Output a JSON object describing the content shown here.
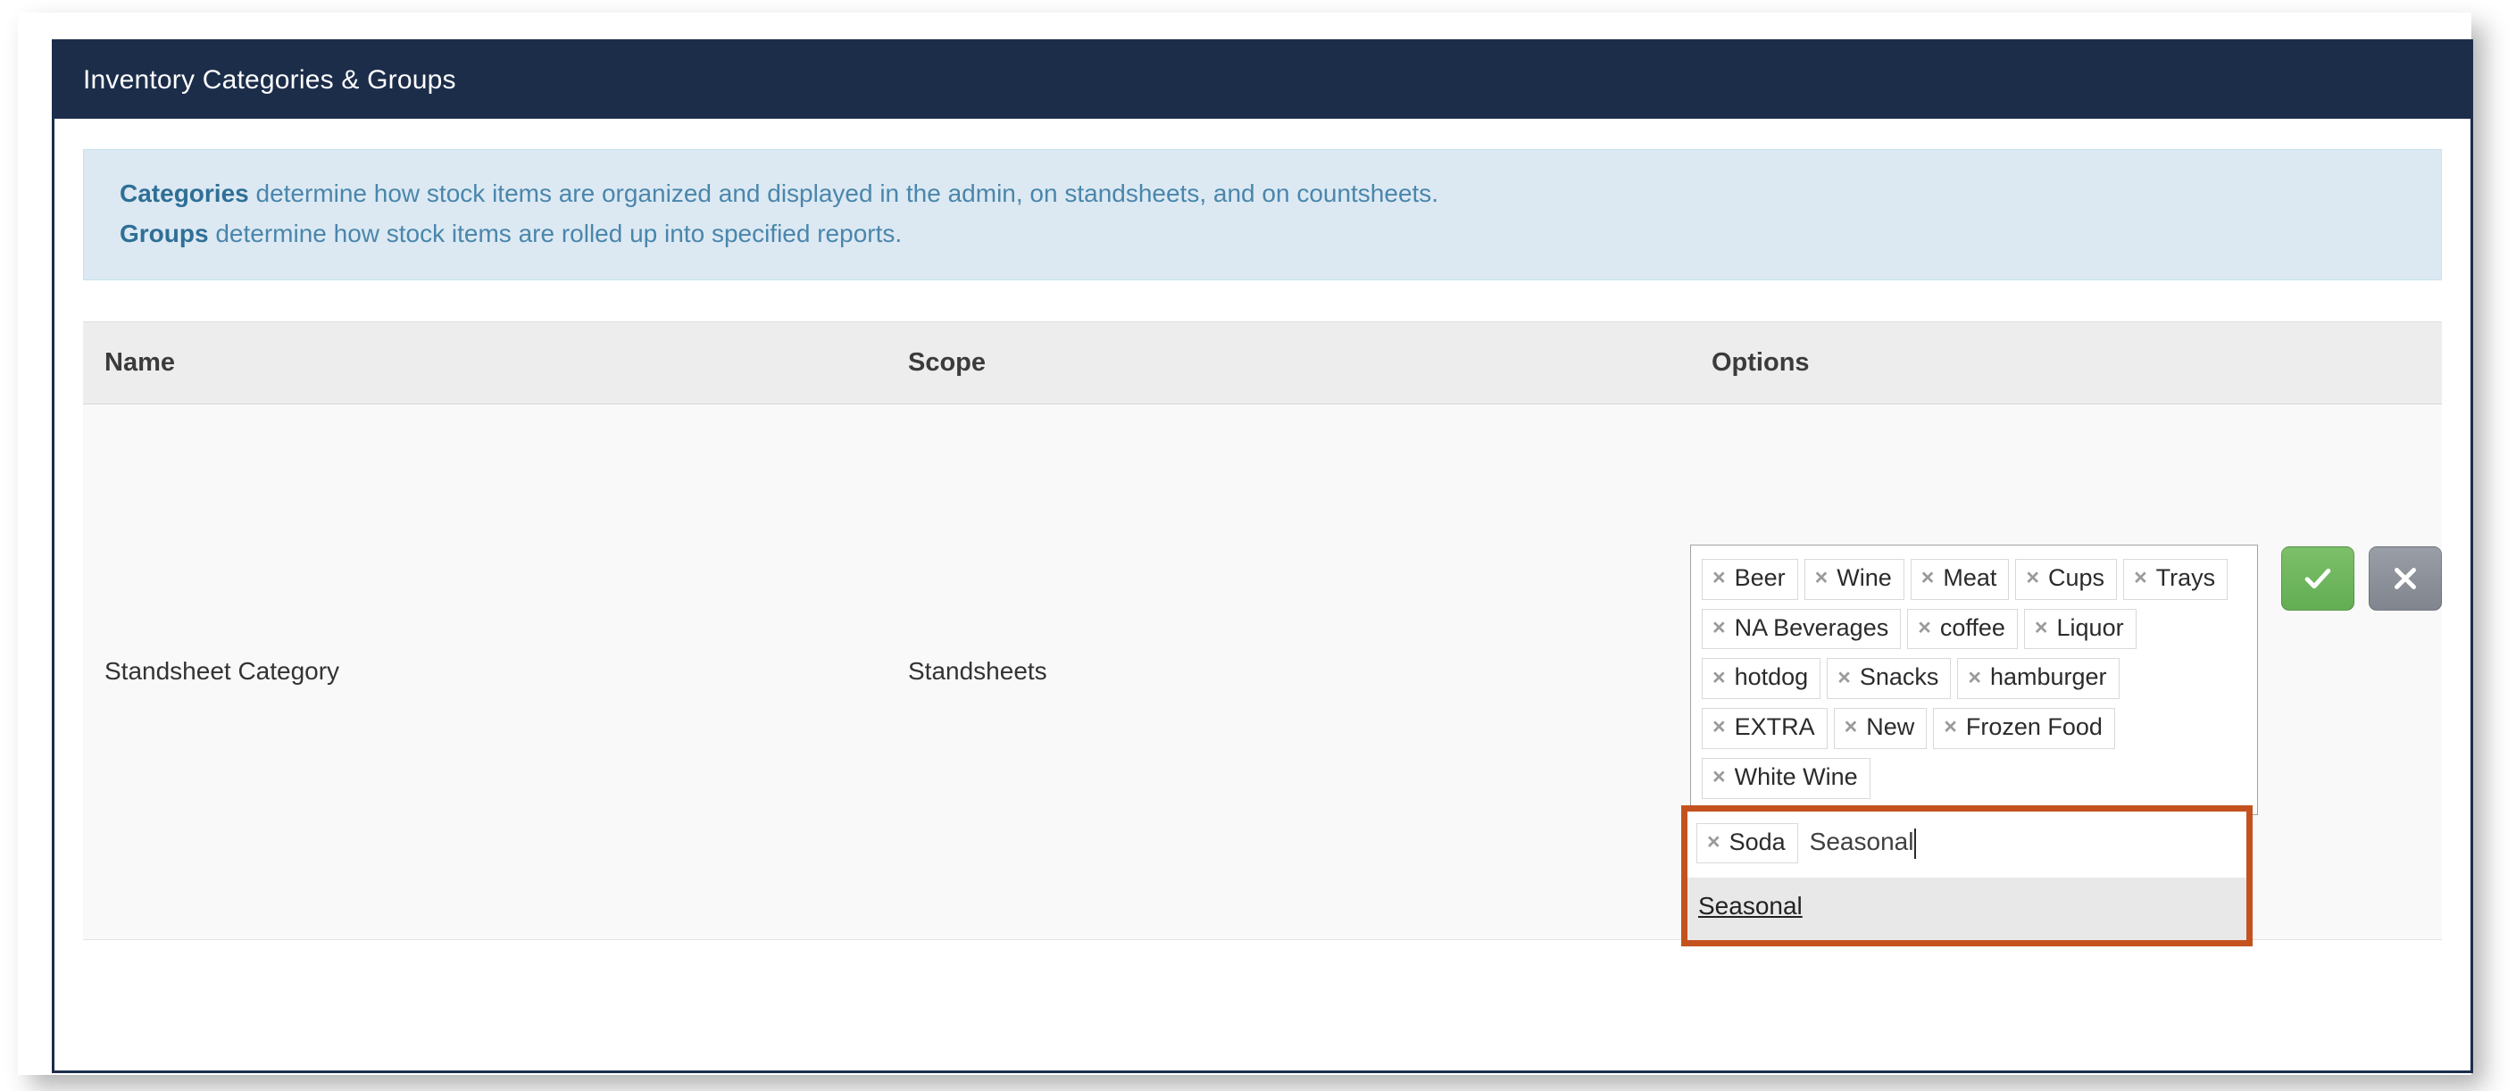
{
  "panel": {
    "title": "Inventory Categories & Groups",
    "colors": {
      "header_navy": "#1c2d4a",
      "alert_bg": "#dce9f3",
      "alert_text": "#4a86ab",
      "highlight_orange": "#c4521f",
      "save_green": "#6eb55c",
      "cancel_gray": "#8b9098"
    }
  },
  "alert": {
    "line1_bold": "Categories",
    "line1_rest": " determine how stock items are organized and displayed in the admin, on standsheets, and on countsheets.",
    "line2_bold": "Groups",
    "line2_rest": " determine how stock items are rolled up into specified reports."
  },
  "table": {
    "headers": [
      "Name",
      "Scope",
      "Options"
    ],
    "rows": [
      {
        "name": "Standsheet Category",
        "scope": "Standsheets"
      }
    ]
  },
  "multiselect": {
    "tags": [
      "Beer",
      "Wine",
      "Meat",
      "Cups",
      "Trays",
      "NA Beverages",
      "coffee",
      "Liquor",
      "hotdog",
      "Snacks",
      "hamburger",
      "EXTRA",
      "New",
      "Frozen Food",
      "White Wine"
    ],
    "remove_icon": "×",
    "input_row": {
      "tag": "Soda",
      "typed_value": "Seasonal"
    },
    "suggestions": [
      "Seasonal"
    ]
  },
  "actions": {
    "save_label": "✓",
    "cancel_label": "×"
  }
}
